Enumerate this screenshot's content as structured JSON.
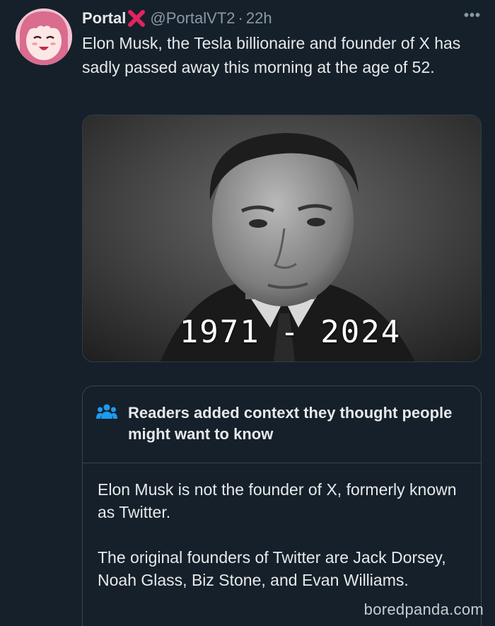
{
  "tweet": {
    "display_name": "Portal",
    "handle": "@PortalVT2",
    "separator": "·",
    "time": "22h",
    "more_label": "•••",
    "text": "Elon Musk, the Tesla billionaire and founder of X has sadly passed away this morning at the age of 52.",
    "media": {
      "caption": "1971 - 2024"
    }
  },
  "community_note": {
    "icon": "people-group-icon",
    "title": "Readers added context they thought people might want to know",
    "paragraphs": [
      "Elon Musk is not the founder of X, formerly known as Twitter.",
      "The original founders of Twitter are Jack Dorsey, Noah Glass, Biz Stone, and Evan Williams."
    ]
  },
  "watermark": "boredpanda.com",
  "colors": {
    "background": "#15202b",
    "text_primary": "#e7e9ea",
    "text_secondary": "#8b98a5",
    "border": "#38444d",
    "note_icon": "#1d9bf0",
    "x_mark": "#e0245e"
  }
}
